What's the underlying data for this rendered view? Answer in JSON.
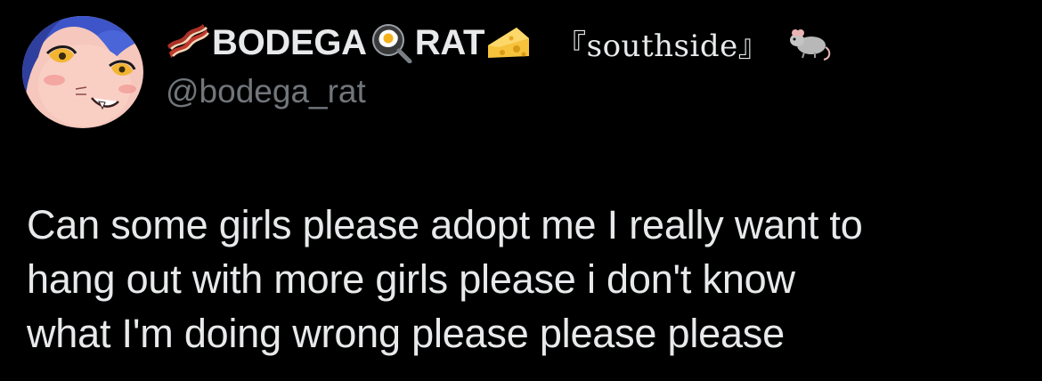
{
  "tweet": {
    "author": {
      "name_prefix_icon": "bacon-icon",
      "name_part1": "BODEGA",
      "name_mid_icon": "frying-pan-egg-icon",
      "name_part2": "RAT",
      "name_cheese_icon": "cheese-icon",
      "name_suffix": "『southside』",
      "name_suffix_icon": "rat-icon",
      "handle": "@bodega_rat",
      "avatar": "avatar-anime-girl-blue-hair"
    },
    "text_lines": [
      "Can some girls please adopt me I really want to",
      "hang out with more girls please i don't know",
      "what I'm doing wrong please please please"
    ]
  },
  "colors": {
    "background": "#000000",
    "primary_text": "#e7e9ea",
    "secondary_text": "#71767b"
  }
}
